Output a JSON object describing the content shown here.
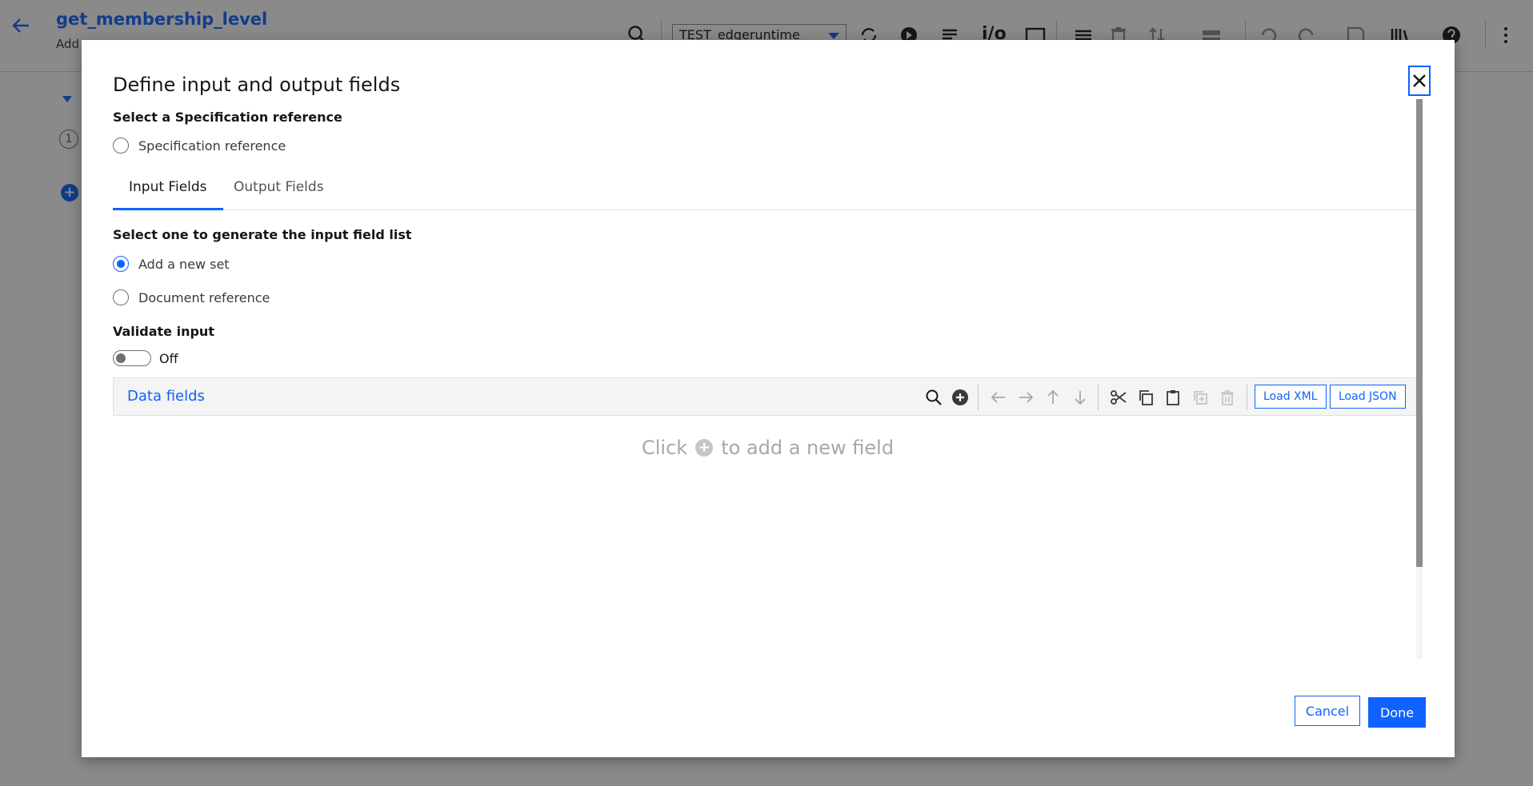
{
  "app": {
    "flow_title": "get_membership_level",
    "flow_subtitle": "Add",
    "runtime": "TEST_edgeruntime",
    "io_label": "i/o",
    "step_number": "1",
    "add_step_symbol": "+"
  },
  "modal": {
    "title": "Define input and output fields",
    "spec_section_label": "Select a Specification reference",
    "spec_option": "Specification reference",
    "tabs": [
      {
        "label": "Input Fields",
        "active": true
      },
      {
        "label": "Output Fields",
        "active": false
      }
    ],
    "generate_label": "Select one to generate the input field list",
    "options": [
      {
        "label": "Add a new set",
        "checked": true
      },
      {
        "label": "Document reference",
        "checked": false
      }
    ],
    "validate_label": "Validate input",
    "validate_state": "Off",
    "data_fields_title": "Data fields",
    "load_xml": "Load XML",
    "load_json": "Load JSON",
    "empty_hint_pre": "Click",
    "empty_hint_post": "to add a new field",
    "cancel": "Cancel",
    "done": "Done"
  },
  "colors": {
    "accent": "#0f62fe",
    "overlay": "#161616",
    "muted": "#a8a8a8"
  },
  "icons": {
    "toolbar": [
      "search-icon",
      "add-circle-icon",
      "arrow-left-icon",
      "arrow-right-icon",
      "arrow-up-icon",
      "arrow-down-icon",
      "cut-icon",
      "copy-icon",
      "paste-icon",
      "duplicate-icon",
      "delete-icon"
    ]
  }
}
